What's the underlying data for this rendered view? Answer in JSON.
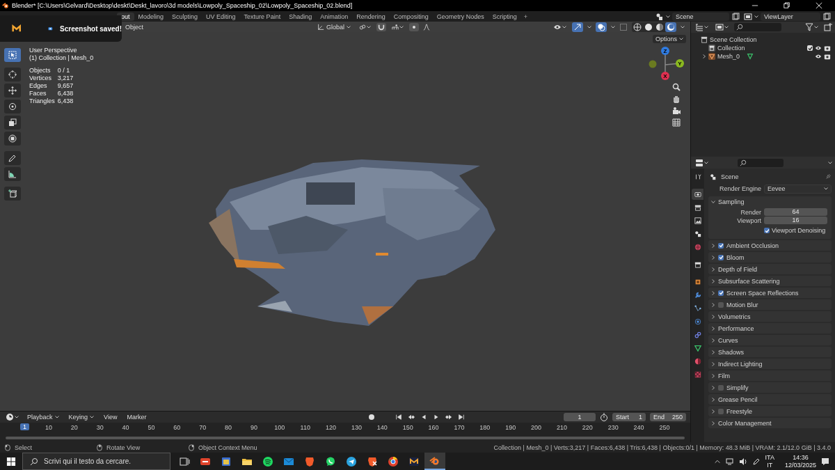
{
  "window": {
    "title": "Blender* [C:\\Users\\Gelvard\\Desktop\\deskt\\Deskt_lavoro\\3d models\\Lowpoly_Spaceship_02\\Lowpoly_Spaceship_02.blend]"
  },
  "workspaces": [
    {
      "label": "out",
      "selected": true
    },
    {
      "label": "Modeling",
      "selected": false
    },
    {
      "label": "Sculpting",
      "selected": false
    },
    {
      "label": "UV Editing",
      "selected": false
    },
    {
      "label": "Texture Paint",
      "selected": false
    },
    {
      "label": "Shading",
      "selected": false
    },
    {
      "label": "Animation",
      "selected": false
    },
    {
      "label": "Rendering",
      "selected": false
    },
    {
      "label": "Compositing",
      "selected": false
    },
    {
      "label": "Geometry Nodes",
      "selected": false
    },
    {
      "label": "Scripting",
      "selected": false
    }
  ],
  "add_workspace": "+",
  "scene": "Scene",
  "view_layer": "ViewLayer",
  "toast": {
    "message": "Screenshot saved!"
  },
  "viewport": {
    "menu": "Object",
    "orientation": "Global",
    "options": "Options",
    "perspective": "User Perspective",
    "context": "(1) Collection | Mesh_0",
    "stats": [
      {
        "label": "Objects",
        "value": "0 / 1"
      },
      {
        "label": "Vertices",
        "value": "3,217"
      },
      {
        "label": "Edges",
        "value": "9,657"
      },
      {
        "label": "Faces",
        "value": "6,438"
      },
      {
        "label": "Triangles",
        "value": "6,438"
      }
    ],
    "gizmo_axes": [
      "Z",
      "Y",
      "X"
    ],
    "tools": [
      {
        "selected": true
      },
      {
        "selected": false
      },
      {
        "selected": false
      },
      {
        "selected": false
      },
      {
        "selected": false
      },
      {
        "selected": false
      },
      {
        "selected": false
      },
      {
        "selected": false
      },
      {
        "selected": false
      }
    ]
  },
  "outliner": {
    "items": [
      {
        "label": "Scene Collection",
        "children": [
          {
            "label": "Collection",
            "kind": "collection",
            "checked": true
          },
          {
            "label": "Mesh_0",
            "kind": "object",
            "expanded": false
          }
        ]
      }
    ]
  },
  "properties": {
    "tabs": [
      {
        "selected": false
      },
      {
        "selected": true
      },
      {
        "selected": false
      },
      {
        "selected": false
      },
      {
        "selected": false
      },
      {
        "selected": false
      },
      {
        "selected": false
      },
      {
        "selected": false
      },
      {
        "selected": false
      },
      {
        "selected": false
      },
      {
        "selected": false
      },
      {
        "selected": false
      },
      {
        "selected": false
      },
      {
        "selected": false
      },
      {
        "selected": false
      }
    ],
    "context": "Scene",
    "render_engine": {
      "label": "Render Engine",
      "value": "Eevee"
    },
    "sampling": {
      "title": "Sampling",
      "expanded": true,
      "fields": [
        {
          "label": "Render",
          "value": "64"
        },
        {
          "label": "Viewport",
          "value": "16"
        }
      ],
      "denoising": {
        "label": "Viewport Denoising",
        "checked": true
      }
    },
    "panels": [
      {
        "title": "Ambient Occlusion",
        "kind": "toggle",
        "checked": true,
        "expanded": false
      },
      {
        "title": "Bloom",
        "kind": "toggle",
        "checked": true,
        "expanded": false
      },
      {
        "title": "Depth of Field",
        "kind": "plain",
        "expanded": false
      },
      {
        "title": "Subsurface Scattering",
        "kind": "plain",
        "expanded": false
      },
      {
        "title": "Screen Space Reflections",
        "kind": "toggle",
        "checked": true,
        "expanded": false
      },
      {
        "title": "Motion Blur",
        "kind": "toggle",
        "checked": false,
        "expanded": false
      },
      {
        "title": "Volumetrics",
        "kind": "plain",
        "expanded": false
      },
      {
        "title": "Performance",
        "kind": "plain",
        "expanded": false
      },
      {
        "title": "Curves",
        "kind": "plain",
        "expanded": false
      },
      {
        "title": "Shadows",
        "kind": "plain",
        "expanded": false
      },
      {
        "title": "Indirect Lighting",
        "kind": "plain",
        "expanded": false
      },
      {
        "title": "Film",
        "kind": "plain",
        "expanded": false
      },
      {
        "title": "Simplify",
        "kind": "toggle",
        "checked": false,
        "expanded": false
      },
      {
        "title": "Grease Pencil",
        "kind": "plain",
        "expanded": false
      },
      {
        "title": "Freestyle",
        "kind": "toggle",
        "checked": false,
        "expanded": false
      },
      {
        "title": "Color Management",
        "kind": "plain",
        "expanded": false
      }
    ]
  },
  "timeline": {
    "menus": [
      "Playback",
      "Keying",
      "View",
      "Marker"
    ],
    "current_frame": "1",
    "playhead": "1",
    "start": {
      "label": "Start",
      "value": "1"
    },
    "end": {
      "label": "End",
      "value": "250"
    },
    "ticks": [
      "10",
      "20",
      "30",
      "40",
      "50",
      "60",
      "70",
      "80",
      "90",
      "100",
      "110",
      "120",
      "130",
      "140",
      "150",
      "160",
      "170",
      "180",
      "190",
      "200",
      "210",
      "220",
      "230",
      "240",
      "250"
    ]
  },
  "status_bar": {
    "hints": [
      "Select",
      "Rotate View",
      "Object Context Menu"
    ],
    "stats": "Collection | Mesh_0 | Verts:3,217 | Faces:6,438 | Tris:6,438 | Objects:0/1 | Memory: 48.3 MiB | VRAM: 2.1/12.0 GiB | 3.4.0"
  },
  "taskbar": {
    "search_placeholder": "Scrivi qui il testo da cercare.",
    "apps": [
      {
        "selected": false
      },
      {
        "selected": false
      },
      {
        "selected": false
      },
      {
        "selected": false
      },
      {
        "selected": false
      },
      {
        "selected": false
      },
      {
        "selected": false
      },
      {
        "selected": false
      },
      {
        "selected": false
      },
      {
        "selected": false
      },
      {
        "selected": false
      },
      {
        "selected": false
      },
      {
        "selected": true
      }
    ],
    "language": "ITA",
    "layout": "IT",
    "time": "14:36",
    "date": "12/03/2025"
  }
}
